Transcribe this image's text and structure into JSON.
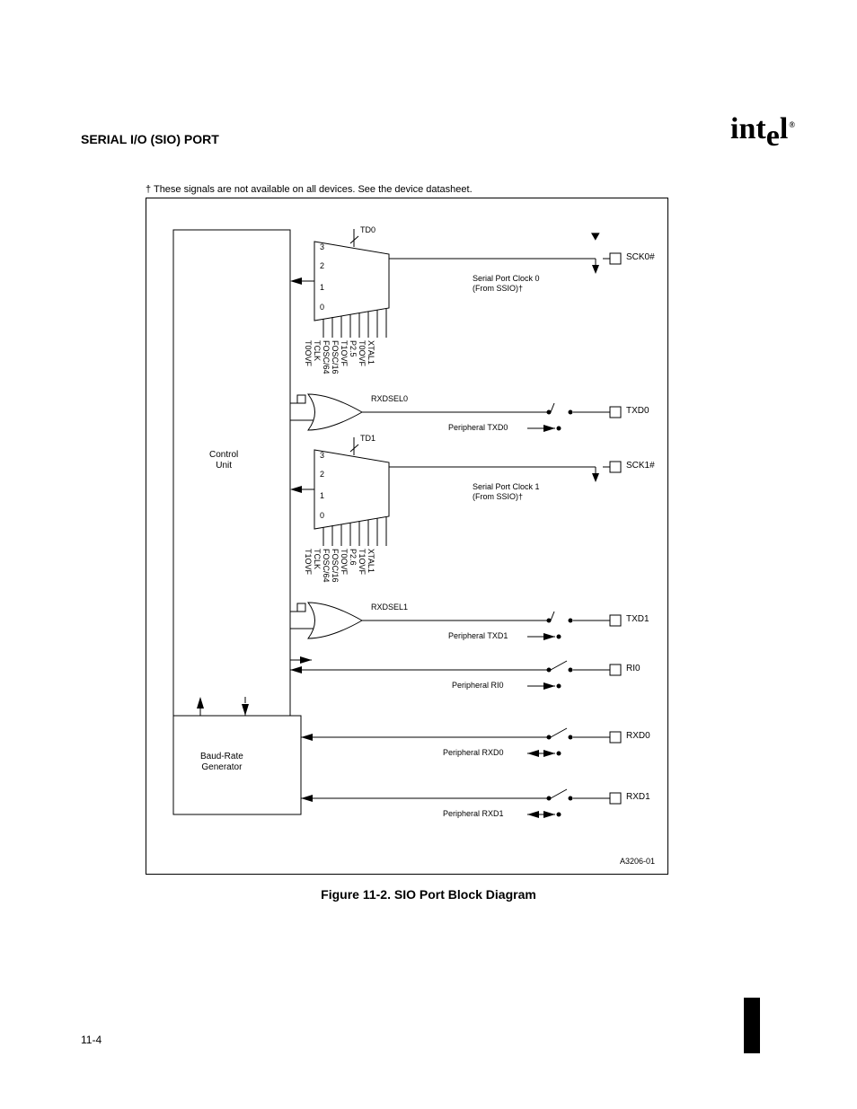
{
  "header": {
    "section_title": "SERIAL I/O (SIO) PORT",
    "logo_text": "intel"
  },
  "figure": {
    "caption": "Figure 11-2.  SIO Port Block Diagram",
    "footnote": "† These signals are not available on all devices. See the device datasheet.",
    "ref_id": "A3206-01",
    "blocks": {
      "control_unit": "Control\nUnit",
      "baud_rate_generator": "Baud-Rate\nGenerator"
    },
    "signals": {
      "sck0_pad": "SCK0#",
      "sck0_in": "Serial Port Clock 0 (From SSIO)†",
      "txd0_pad": "TXD0",
      "txd0_ph": "Peripheral TXD0",
      "or0_out": "RXDSEL0",
      "sck1_pad": "SCK1#",
      "sck1_in": "Serial Port Clock 1 (From SSIO)†",
      "txd1_pad": "TXD1",
      "txd1_ph": "Peripheral TXD1",
      "or1_out": "RXDSEL1",
      "ri0_pad": "RI0",
      "ri0_ph": "Peripheral RI0",
      "rxd0_pad": "RXD0",
      "rxd0_ph": "Peripheral RXD0",
      "rxd1_pad": "RXD1",
      "rxd1_ph": "Peripheral RXD1"
    },
    "mux": {
      "m0_sel": "TD0",
      "m1_sel": "TD1",
      "m0_bits": [
        "3",
        "2",
        "1",
        "0"
      ],
      "m1_bits": [
        "3",
        "2",
        "1",
        "0"
      ],
      "m0_pins": [
        "T0OVF",
        "TCLK",
        "FOSC/64",
        "FOSC/16",
        "T1OVF",
        "P2.5",
        "T0OVF",
        "XTAL1"
      ],
      "m1_pins": [
        "T1OVF",
        "TCLK",
        "FOSC/64",
        "FOSC/16",
        "T0OVF",
        "P2.6",
        "T1OVF",
        "XTAL1"
      ]
    }
  },
  "page_number": "11-4"
}
